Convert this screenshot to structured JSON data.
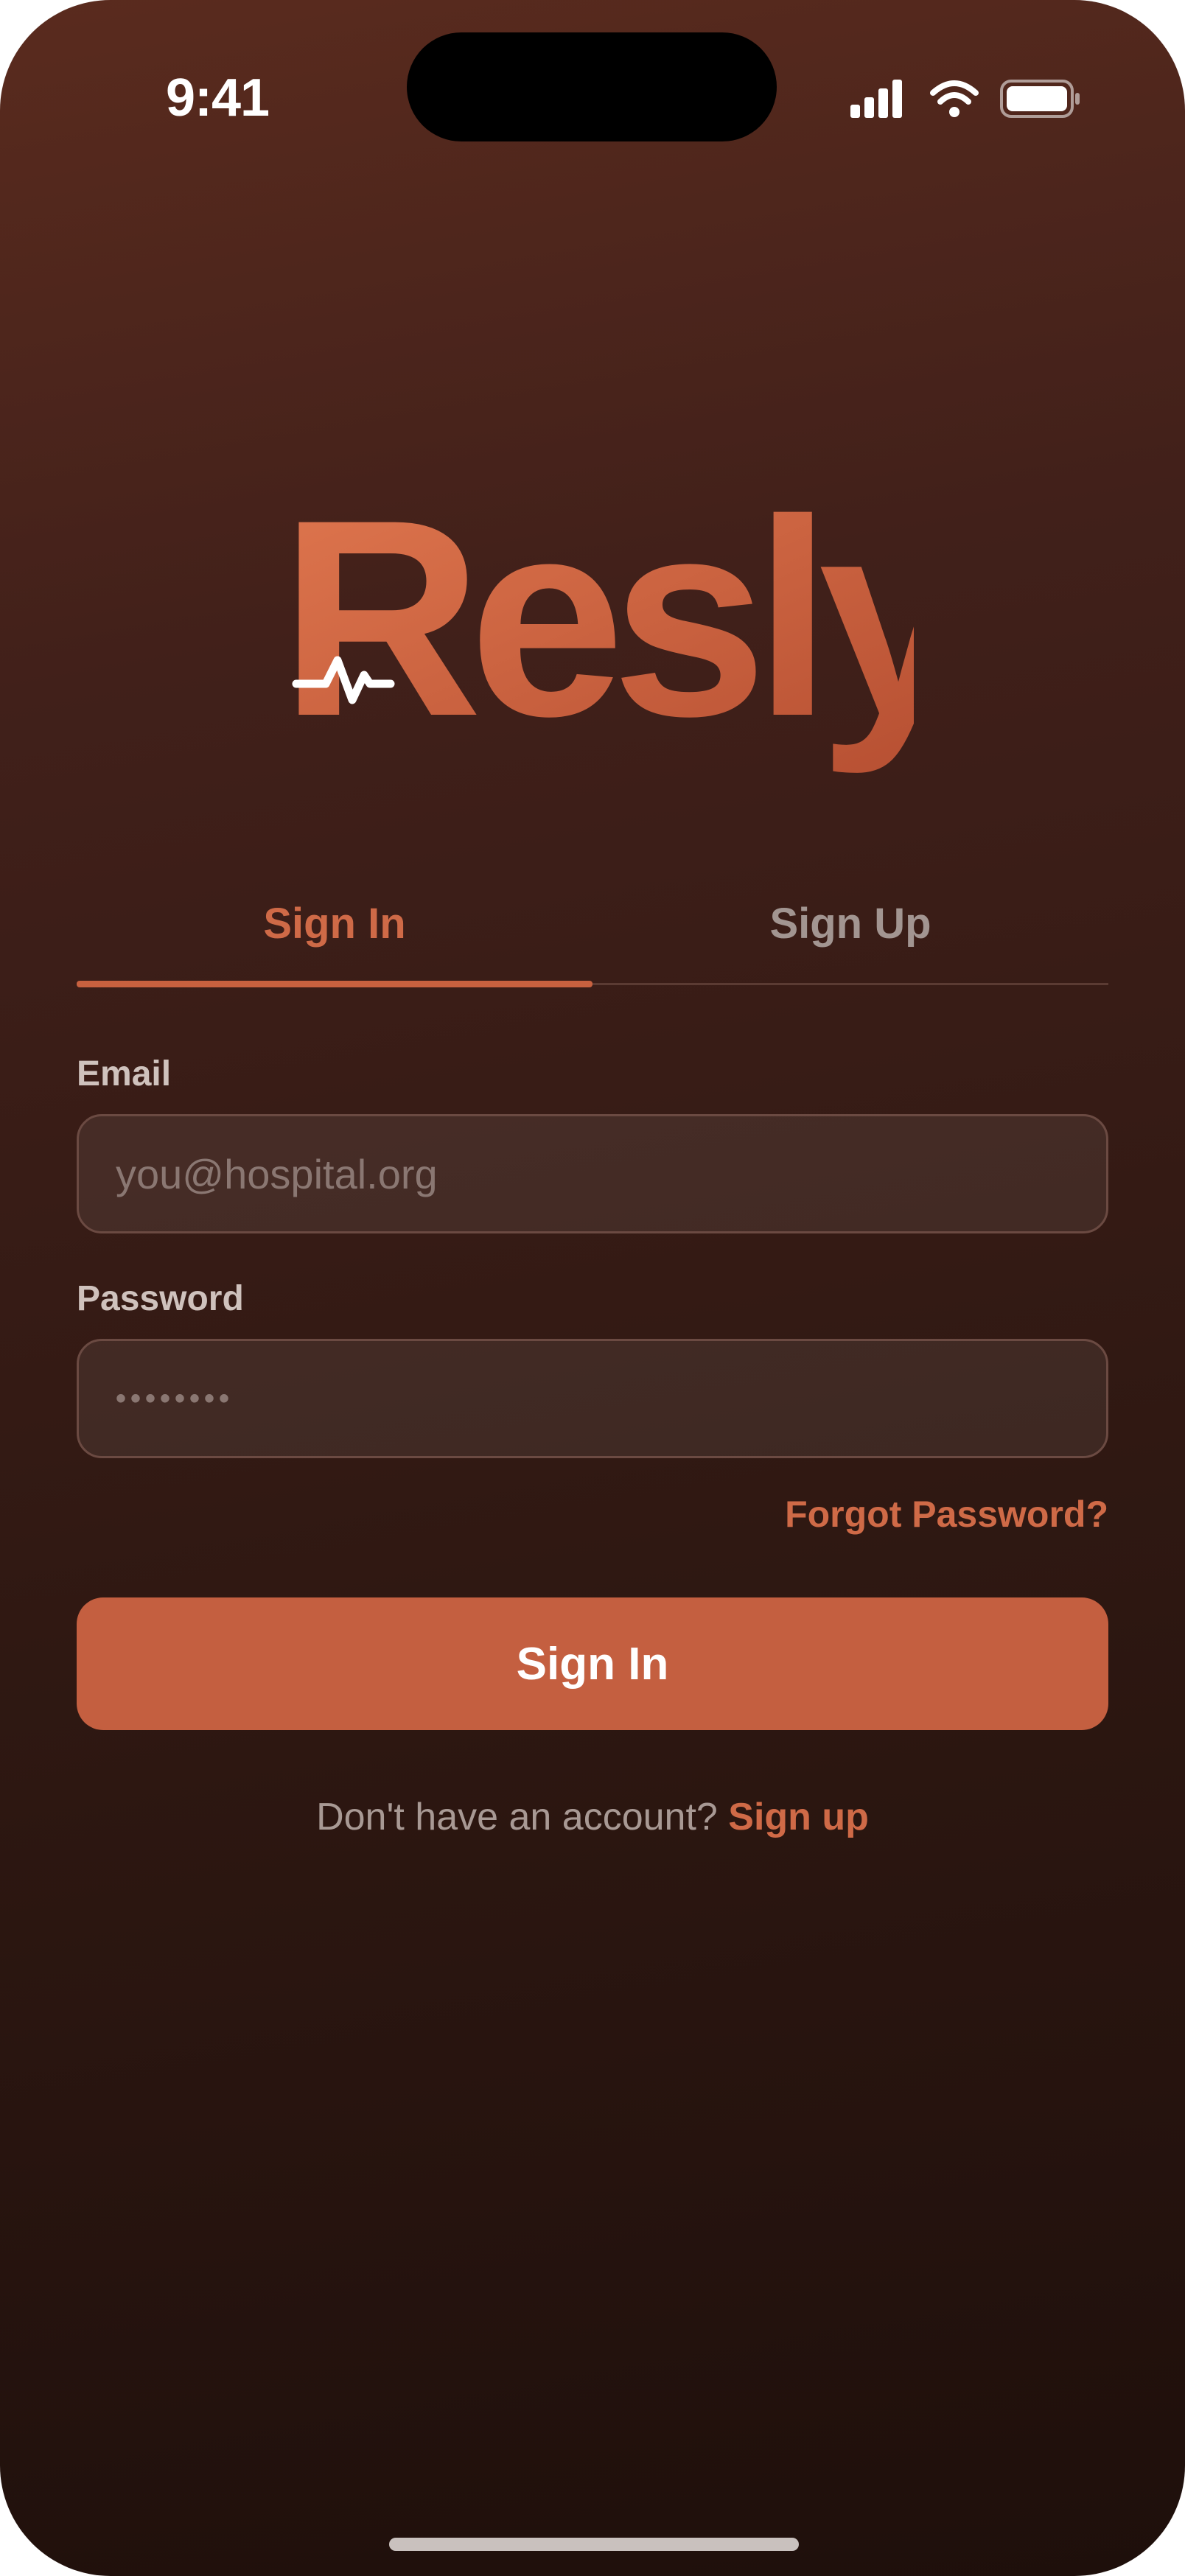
{
  "status_bar": {
    "time": "9:41",
    "icons": [
      "signal-icon",
      "wifi-icon",
      "battery-icon"
    ]
  },
  "logo": {
    "wordmark": "Resly",
    "icon": "heartbeat-icon",
    "color": "#c8613f"
  },
  "tabs": [
    {
      "label": "Sign In",
      "active": true
    },
    {
      "label": "Sign Up",
      "active": false
    }
  ],
  "form": {
    "email_label": "Email",
    "email_placeholder": "you@hospital.org",
    "password_label": "Password",
    "password_value": "••••••••",
    "forgot_label": "Forgot Password?",
    "submit_label": "Sign In"
  },
  "footer": {
    "prompt": "Don't have an account?",
    "link": "Sign up"
  },
  "colors": {
    "accent": "#c45f40",
    "background_top": "#5a2b1e",
    "background_bottom": "#1e0f0b"
  }
}
